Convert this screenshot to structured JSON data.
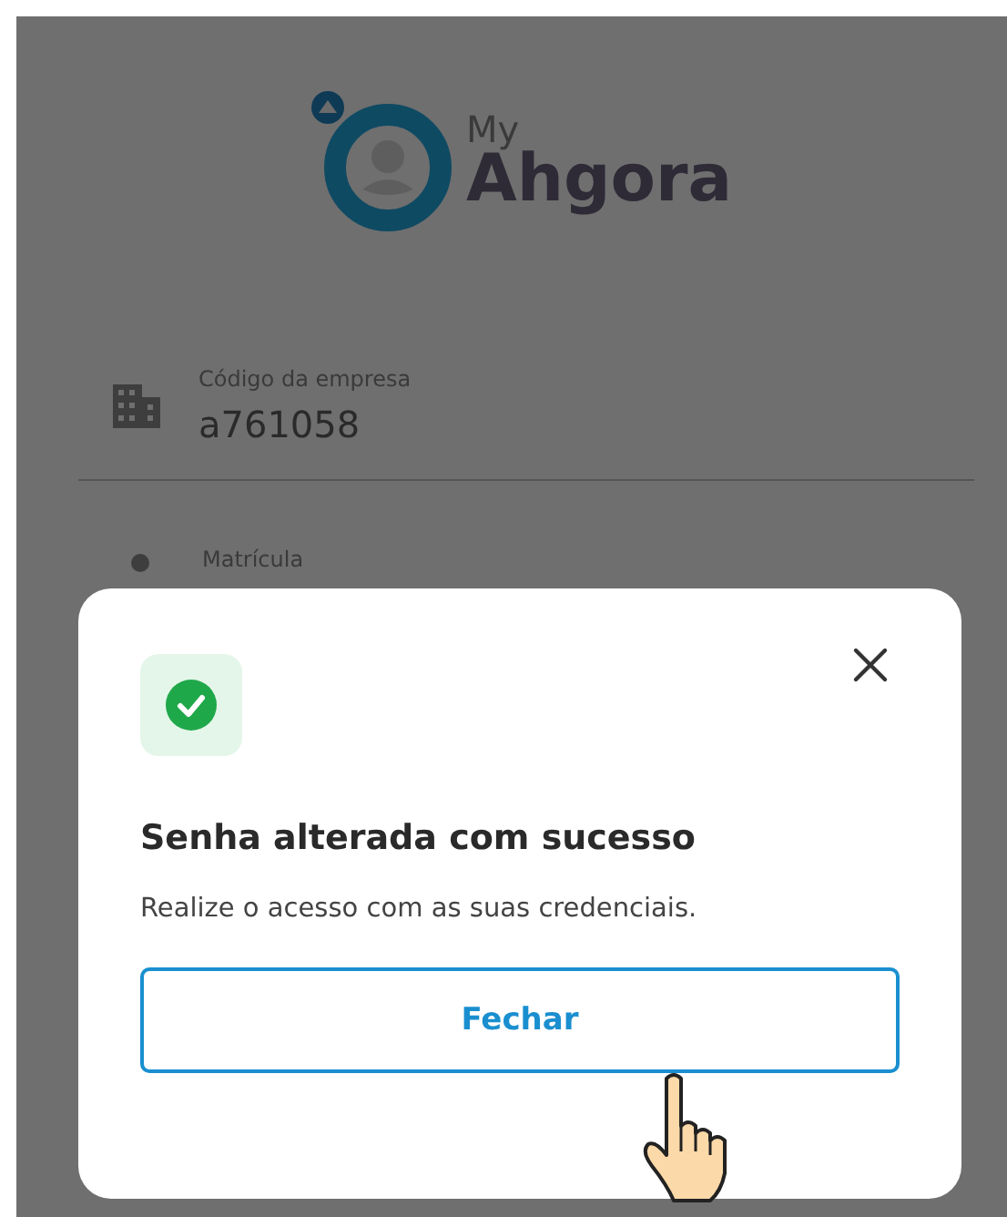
{
  "logo": {
    "small": "My",
    "big": "Ahgora"
  },
  "fields": [
    {
      "label": "Código da empresa",
      "value": "a761058"
    },
    {
      "label": "Matrícula"
    }
  ],
  "dialog": {
    "title": "Senha alterada com sucesso",
    "message": "Realize o acesso com as suas credenciais.",
    "button": "Fechar"
  }
}
